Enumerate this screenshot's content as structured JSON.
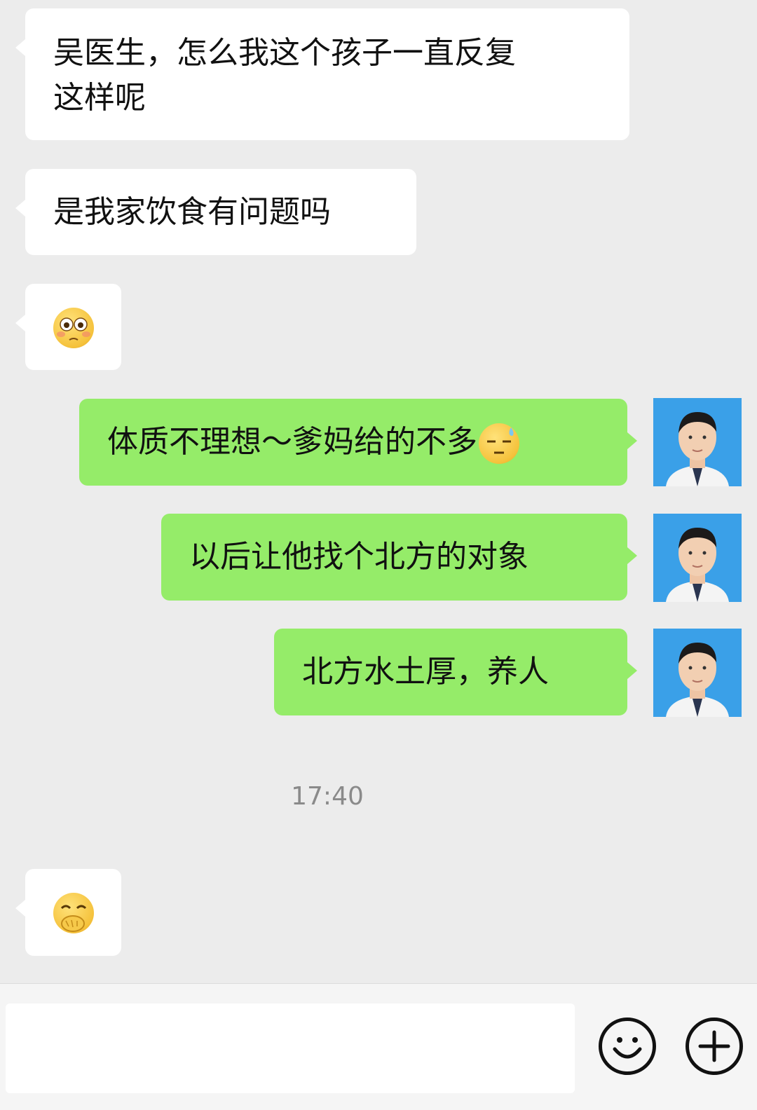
{
  "messages": [
    {
      "side": "in",
      "text": "吴医生，怎么我这个孩子一直反复\n这样呢"
    },
    {
      "side": "in",
      "text": "是我家饮食有问题吗"
    },
    {
      "side": "in",
      "emoji": "flushed-face"
    },
    {
      "side": "out",
      "text": "体质不理想～爹妈给的不多",
      "emoji": "sweat-face"
    },
    {
      "side": "out",
      "text": "以后让他找个北方的对象"
    },
    {
      "side": "out",
      "text": "北方水土厚，养人"
    }
  ],
  "timestamp": "17:40",
  "last_message": {
    "side": "in",
    "emoji": "covering-mouth-smile"
  },
  "input": {
    "value": "",
    "emoji_button_icon": "smile-icon",
    "plus_button_icon": "plus-icon"
  },
  "colors": {
    "background": "#ececec",
    "incoming": "#ffffff",
    "outgoing": "#95ec69",
    "avatar_bg": "#3aa0e8"
  }
}
